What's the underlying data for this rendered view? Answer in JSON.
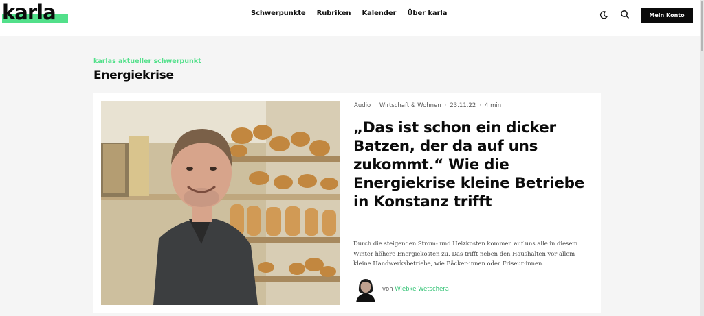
{
  "header": {
    "logo": "karla",
    "nav": [
      "Schwerpunkte",
      "Rubriken",
      "Kalender",
      "Über karla"
    ],
    "account_button": "Mein Konto"
  },
  "colors": {
    "accent": "#52e08a",
    "dark": "#0b0b0b",
    "background": "#f5f5f5"
  },
  "icons": {
    "theme": "moon-icon",
    "search": "search-icon"
  },
  "section": {
    "kicker": "karlas aktueller schwerpunkt",
    "title": "Energiekrise"
  },
  "article": {
    "meta": {
      "format": "Audio",
      "category": "Wirtschaft & Wohnen",
      "date": "23.11.22",
      "duration": "4 min"
    },
    "headline": "„Das ist schon ein dicker Batzen, der da auf uns zukommt.“ Wie die Energiekrise kleine Betriebe in Konstanz trifft",
    "teaser": "Durch die steigenden Strom- und Heizkosten kommen auf uns alle in diesem Winter höhere Energiekosten zu. Das trifft neben den Haushalten vor allem kleine Handwerksbetriebe, wie Bäcker:innen oder Friseur:innen.",
    "author_prefix": "von",
    "author_name": "Wiebke Wetschera"
  }
}
